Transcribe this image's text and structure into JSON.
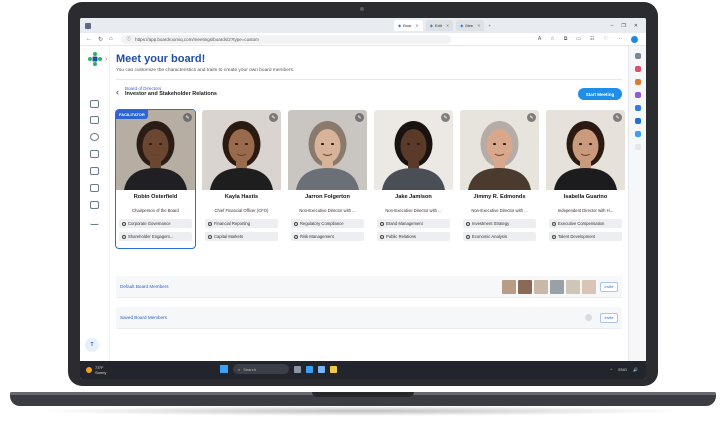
{
  "browser": {
    "tabs": [
      {
        "label": "Boar",
        "active": true
      },
      {
        "label": "Edit",
        "active": false
      },
      {
        "label": "Mee",
        "active": false
      }
    ],
    "new_tab": "+",
    "url": "https://app.boardroomiq.com/meetings/boards/2?type=custom",
    "window_controls": [
      "–",
      "❐",
      "✕"
    ]
  },
  "app": {
    "title": "Meet your board!",
    "subtitle": "You can customize the characteristics and traits to create your own board members.",
    "breadcrumb_parent": "Board of Directors",
    "breadcrumb_current": "Investor and Stakeholder Relations",
    "start_meeting_label": "Start Meeting",
    "user_initial": "T",
    "accent_color": "#1e8ee8",
    "brand_color": "#1f4ea3"
  },
  "members": [
    {
      "name": "Robin Osterfield",
      "role": "Chairperson of the Board",
      "badge": "FACILITATOR",
      "expertise": [
        "Corporate Governance",
        "Shareholder Engagem..."
      ]
    },
    {
      "name": "Kayla Hastis",
      "role": "Chief Financial Officer (CFO)",
      "expertise": [
        "Financial Reporting",
        "Capital Markets"
      ]
    },
    {
      "name": "Jarron Folgerton",
      "role": "Non-Executive Director with ...",
      "expertise": [
        "Regulatory Compliance",
        "Risk Management"
      ]
    },
    {
      "name": "Jake Jamison",
      "role": "Non-Executive Director with ...",
      "expertise": [
        "Brand Management",
        "Public Relations"
      ]
    },
    {
      "name": "Jimmy R. Edmonds",
      "role": "Non-Executive Director with ...",
      "expertise": [
        "Investment Strategy",
        "Economic Analysis"
      ]
    },
    {
      "name": "Isabella Guarino",
      "role": "Independent Director with H...",
      "expertise": [
        "Executive Compensation",
        "Talent Development"
      ]
    }
  ],
  "panels": {
    "default_label": "Default Board Members",
    "saved_label": "Saved Board Members",
    "invite_label": "Invite"
  },
  "taskbar": {
    "temperature": "73°F",
    "condition": "Sunny",
    "search_placeholder": "Search",
    "tray": [
      "^",
      "ENG",
      "🔊"
    ]
  }
}
